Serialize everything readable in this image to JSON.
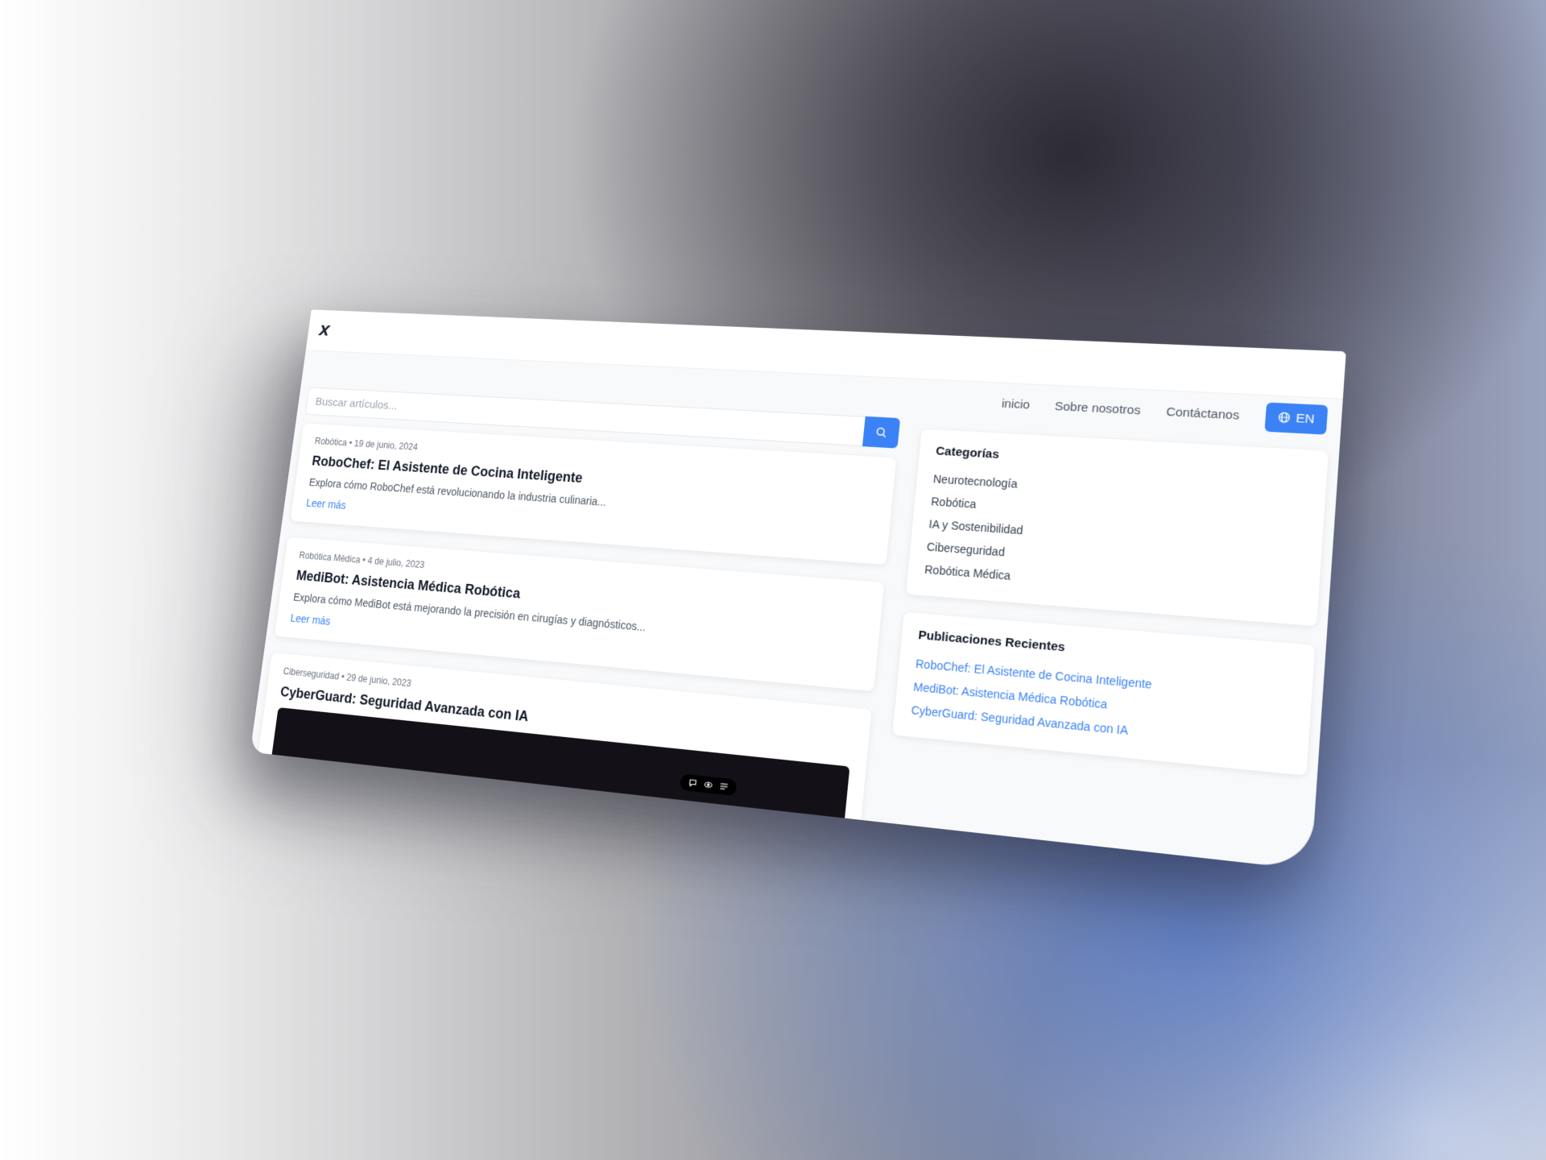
{
  "header": {
    "logo": "X"
  },
  "nav": {
    "items": [
      "inicio",
      "Sobre nosotros",
      "Contáctanos"
    ],
    "lang_label": "EN"
  },
  "search": {
    "placeholder": "Buscar artículos..."
  },
  "articles": [
    {
      "meta": "Robótica • 19 de junio, 2024",
      "title": "RoboChef: El Asistente de Cocina Inteligente",
      "excerpt": "Explora cómo RoboChef está revolucionando la industria culinaria...",
      "read_more": "Leer más"
    },
    {
      "meta": "Robótica Médica • 4 de julio, 2023",
      "title": "MediBot: Asistencia Médica Robótica",
      "excerpt": "Explora cómo MediBot está mejorando la precisión en cirugías y diagnósticos...",
      "read_more": "Leer más"
    },
    {
      "meta": "Ciberseguridad • 29 de junio, 2023",
      "title": "CyberGuard: Seguridad Avanzada con IA"
    }
  ],
  "sidebar": {
    "categories_title": "Categorías",
    "categories": [
      "Neurotecnología",
      "Robótica",
      "IA y Sostenibilidad",
      "Ciberseguridad",
      "Robótica Médica"
    ],
    "recent_title": "Publicaciones Recientes",
    "recent": [
      "RoboChef: El Asistente de Cocina Inteligente",
      "MediBot: Asistencia Médica Robótica",
      "CyberGuard: Seguridad Avanzada con IA"
    ]
  },
  "toolbar": {
    "icons": [
      "chat-icon",
      "eye-icon",
      "menu-icon"
    ]
  },
  "colors": {
    "accent": "#3b82f6",
    "text_dark": "#111827",
    "muted": "#6b7280"
  }
}
